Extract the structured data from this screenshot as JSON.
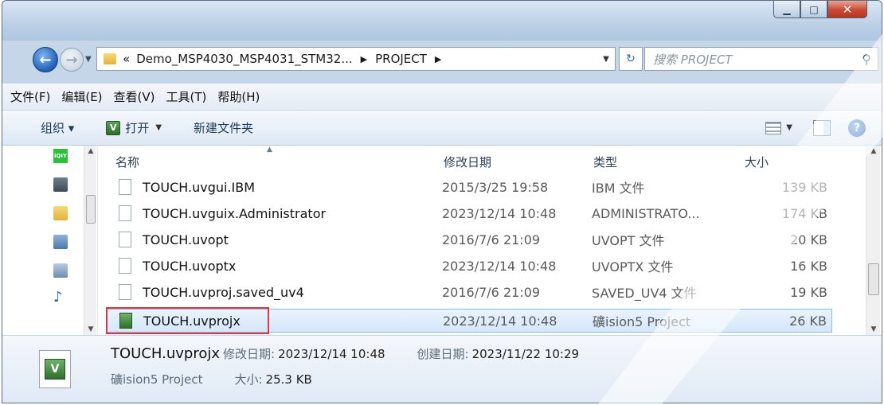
{
  "address": {
    "crumbs": [
      "«",
      "Demo_MSP4030_MSP4031_STM32...",
      "PROJECT"
    ],
    "search_placeholder": "搜索 PROJECT"
  },
  "menu": [
    "文件(F)",
    "编辑(E)",
    "查看(V)",
    "工具(T)",
    "帮助(H)"
  ],
  "commands": {
    "organize": "组织 ▾",
    "open": "打开",
    "new_folder": "新建文件夹"
  },
  "columns": {
    "name": "名称",
    "date": "修改日期",
    "type": "类型",
    "size": "大小"
  },
  "files": [
    {
      "name": "TOUCH.uvgui.IBM",
      "date": "2015/3/25 19:58",
      "type": "IBM 文件",
      "size": "139 KB"
    },
    {
      "name": "TOUCH.uvguix.Administrator",
      "date": "2023/12/14 10:48",
      "type": "ADMINISTRATO...",
      "size": "174 KB"
    },
    {
      "name": "TOUCH.uvopt",
      "date": "2016/7/6 21:09",
      "type": "UVOPT 文件",
      "size": "20 KB"
    },
    {
      "name": "TOUCH.uvoptx",
      "date": "2023/12/14 10:48",
      "type": "UVOPTX 文件",
      "size": "16 KB"
    },
    {
      "name": "TOUCH.uvproj.saved_uv4",
      "date": "2016/7/6 21:09",
      "type": "SAVED_UV4 文件",
      "size": "19 KB"
    },
    {
      "name": "TOUCH.uvprojx",
      "date": "2023/12/14 10:48",
      "type": "礦ision5 Project",
      "size": "26 KB"
    }
  ],
  "details": {
    "name": "TOUCH.uvprojx",
    "modified_label": "修改日期:",
    "modified": "2023/12/14 10:48",
    "created_label": "创建日期:",
    "created": "2023/11/22 10:29",
    "type": "礦ision5 Project",
    "size_label": "大小:",
    "size": "25.3 KB"
  },
  "nav_icons": [
    "iqiyi-icon",
    "library-icon",
    "folder-icon",
    "computer-icon",
    "document-icon",
    "music-icon"
  ],
  "colors": {
    "selection": "#d4e7fb",
    "highlight_box": "#e0373a"
  }
}
